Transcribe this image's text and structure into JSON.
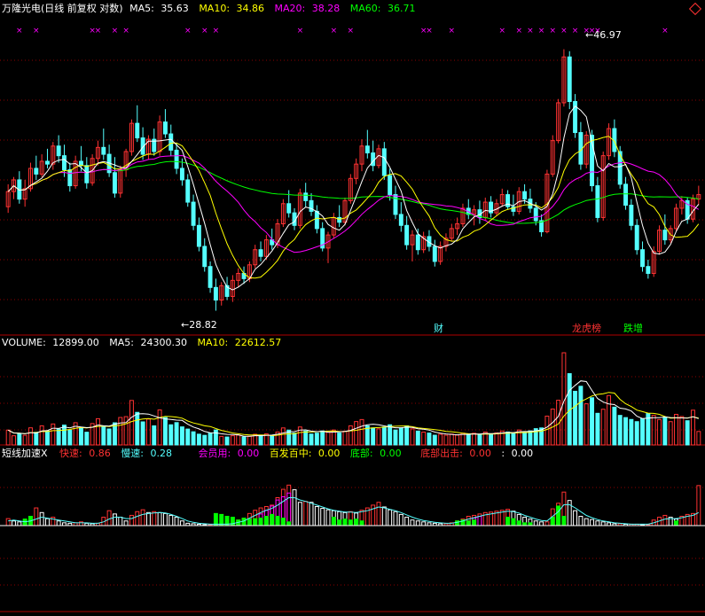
{
  "stock": {
    "name": "万隆光电",
    "mode": "(日线 前复权 对数)"
  },
  "colors": {
    "up": "#ff3232",
    "down": "#54ffff",
    "ma5": "#ffffff",
    "ma10": "#ffff00",
    "ma20": "#ff00ff",
    "ma60": "#00ff00",
    "grid": "#8b0000",
    "flat": "#ffffff"
  },
  "price_panel": {
    "ma5": {
      "label": "MA5:",
      "value": "35.63"
    },
    "ma10": {
      "label": "MA10:",
      "value": "34.86"
    },
    "ma20": {
      "label": "MA20:",
      "value": "38.28"
    },
    "ma60": {
      "label": "MA60:",
      "value": "36.71"
    },
    "high_label": "46.97",
    "low_label": "28.82",
    "event_tags": [
      "财",
      "龙虎榜",
      "跌增"
    ]
  },
  "volume_panel": {
    "volume": {
      "label": "VOLUME:",
      "value": "12899.00"
    },
    "ma5": {
      "label": "MA5:",
      "value": "24300.30"
    },
    "ma10": {
      "label": "MA10:",
      "value": "22612.57"
    }
  },
  "indicator_panel": {
    "title": "短线加速X",
    "fast": {
      "label": "快速:",
      "value": "0.86"
    },
    "slow": {
      "label": "慢速:",
      "value": "0.28"
    },
    "member": {
      "label": "会员用:",
      "value": "0.00"
    },
    "hundred": {
      "label": "百发百中:",
      "value": "0.00"
    },
    "bottom": {
      "label": "底部:",
      "value": "0.00"
    },
    "bottom_out": {
      "label": "底部出击:",
      "value": "0.00"
    },
    "extra": {
      "label": ":",
      "value": "0.00"
    }
  },
  "chart_data": {
    "type": "candlestick",
    "price_range": [
      28.0,
      49.0
    ],
    "volume_range": [
      0,
      90000
    ],
    "indicator_range": [
      0,
      1.2
    ],
    "ohlc": [
      [
        35,
        36.5,
        34.6,
        36
      ],
      [
        36,
        37,
        35.5,
        36.8
      ],
      [
        36.8,
        37.4,
        35.2,
        35.5
      ],
      [
        35.5,
        36.8,
        35,
        36.2
      ],
      [
        36.2,
        38,
        36,
        37.6
      ],
      [
        37.6,
        38.5,
        36.8,
        37.2
      ],
      [
        37.2,
        38.6,
        37,
        38.1
      ],
      [
        38.1,
        39,
        37.6,
        37.9
      ],
      [
        37.9,
        39.5,
        37.5,
        39.2
      ],
      [
        39.2,
        40,
        38,
        38.5
      ],
      [
        38.5,
        39.3,
        37,
        37.5
      ],
      [
        37.5,
        38,
        36,
        36.4
      ],
      [
        36.4,
        38.5,
        36.2,
        38.1
      ],
      [
        38.1,
        39.2,
        37.4,
        37.8
      ],
      [
        37.8,
        38.4,
        36.2,
        36.6
      ],
      [
        36.6,
        38.6,
        36.4,
        38.3
      ],
      [
        38.3,
        39.6,
        37.8,
        39.1
      ],
      [
        39.1,
        40.5,
        38.2,
        38.6
      ],
      [
        38.6,
        39.3,
        37,
        37.3
      ],
      [
        37.3,
        38.4,
        35.6,
        35.9
      ],
      [
        35.9,
        37.8,
        35.6,
        37.5
      ],
      [
        37.5,
        39,
        37,
        38.8
      ],
      [
        38.8,
        41.2,
        38.5,
        40.9
      ],
      [
        40.9,
        42.3,
        39.5,
        39.8
      ],
      [
        39.8,
        40.6,
        38.2,
        38.6
      ],
      [
        38.6,
        40,
        38.2,
        39.7
      ],
      [
        39.7,
        40.5,
        38.5,
        38.8
      ],
      [
        38.8,
        41.5,
        38.5,
        41
      ],
      [
        41,
        42,
        39.8,
        40.1
      ],
      [
        40.1,
        40.8,
        38.5,
        38.9
      ],
      [
        38.9,
        39.4,
        37.2,
        37.6
      ],
      [
        37.6,
        38.3,
        36.4,
        36.8
      ],
      [
        36.8,
        37.2,
        35,
        35.3
      ],
      [
        35.3,
        35.8,
        33.5,
        33.8
      ],
      [
        33.8,
        34.3,
        32.2,
        32.5
      ],
      [
        32.5,
        33,
        31,
        31.3
      ],
      [
        31.3,
        31.6,
        29.8,
        30.1
      ],
      [
        30.1,
        30.6,
        28.82,
        29.4
      ],
      [
        29.4,
        30.4,
        29.1,
        30.2
      ],
      [
        30.2,
        30.7,
        29.4,
        29.6
      ],
      [
        29.6,
        30.8,
        29.3,
        30.5
      ],
      [
        30.5,
        31.2,
        30.1,
        30.9
      ],
      [
        30.9,
        31.3,
        30.3,
        30.6
      ],
      [
        30.6,
        31.6,
        30.4,
        31.4
      ],
      [
        31.4,
        32.6,
        31.2,
        32.3
      ],
      [
        32.3,
        32.8,
        31.6,
        31.9
      ],
      [
        31.9,
        33.2,
        31.7,
        32.9
      ],
      [
        32.9,
        33.6,
        32.3,
        32.6
      ],
      [
        32.6,
        34.2,
        32.4,
        33.9
      ],
      [
        33.9,
        35.5,
        33.7,
        35.2
      ],
      [
        35.2,
        36.1,
        34.3,
        34.6
      ],
      [
        34.6,
        34.9,
        33.5,
        33.8
      ],
      [
        33.8,
        36.2,
        33.6,
        35.9
      ],
      [
        35.9,
        36.6,
        35,
        35.4
      ],
      [
        35.4,
        35.9,
        34.4,
        34.7
      ],
      [
        34.7,
        35.1,
        33.3,
        33.6
      ],
      [
        33.6,
        34,
        32.2,
        32.4
      ],
      [
        32.4,
        33.4,
        31.5,
        33.2
      ],
      [
        33.2,
        34.6,
        33,
        34.3
      ],
      [
        34.3,
        35.1,
        33.7,
        34
      ],
      [
        34,
        35.6,
        33.8,
        35.4
      ],
      [
        35.4,
        37.2,
        35.2,
        36.9
      ],
      [
        36.9,
        38.3,
        36.5,
        37.9
      ],
      [
        37.9,
        39.7,
        37.4,
        39.2
      ],
      [
        39.2,
        40.4,
        38.3,
        38.7
      ],
      [
        38.7,
        39.6,
        37.4,
        37.8
      ],
      [
        37.8,
        39.3,
        37.6,
        39
      ],
      [
        39,
        39.5,
        36.8,
        37.1
      ],
      [
        37.1,
        37.6,
        35.4,
        35.8
      ],
      [
        35.8,
        36.4,
        34.2,
        34.5
      ],
      [
        34.5,
        35.3,
        33.4,
        33.8
      ],
      [
        33.8,
        34.4,
        32.3,
        32.6
      ],
      [
        32.6,
        33.5,
        31.6,
        33.2
      ],
      [
        33.2,
        33.6,
        32,
        32.3
      ],
      [
        32.3,
        33.4,
        32.1,
        33.1
      ],
      [
        33.1,
        33.5,
        32.2,
        32.5
      ],
      [
        32.5,
        32.9,
        31.3,
        31.6
      ],
      [
        31.6,
        32.8,
        31.4,
        32.5
      ],
      [
        32.5,
        33.3,
        32.2,
        33
      ],
      [
        33,
        33.9,
        32.8,
        33.6
      ],
      [
        33.6,
        34.3,
        33.2,
        33.9
      ],
      [
        33.9,
        35.2,
        33.7,
        34.9
      ],
      [
        34.9,
        35.5,
        34.2,
        34.5
      ],
      [
        34.5,
        35.1,
        33.8,
        34.8
      ],
      [
        34.8,
        35.4,
        33.9,
        34.3
      ],
      [
        34.3,
        35.6,
        34.1,
        35.3
      ],
      [
        35.3,
        35.7,
        34.3,
        34.6
      ],
      [
        34.6,
        35.5,
        34.4,
        35.2
      ],
      [
        35.2,
        36.2,
        35,
        35.8
      ],
      [
        35.8,
        36.1,
        34.8,
        35
      ],
      [
        35,
        35.8,
        34.4,
        34.7
      ],
      [
        34.7,
        36.3,
        34.5,
        36
      ],
      [
        36,
        36.5,
        35.2,
        35.5
      ],
      [
        35.5,
        36.2,
        34.6,
        34.9
      ],
      [
        34.9,
        35.3,
        33.8,
        34.1
      ],
      [
        34.1,
        34.5,
        33.1,
        33.4
      ],
      [
        33.4,
        37.5,
        33.3,
        37.2
      ],
      [
        37.2,
        40,
        37,
        39.6
      ],
      [
        39.6,
        42.8,
        39.4,
        42.5
      ],
      [
        42.5,
        46.97,
        42.2,
        46.3
      ],
      [
        46.3,
        46.8,
        42,
        42.6
      ],
      [
        42.6,
        43.2,
        39.8,
        40.2
      ],
      [
        40.2,
        41,
        37.5,
        37.9
      ],
      [
        37.9,
        40.3,
        37.6,
        40
      ],
      [
        40,
        40.4,
        36,
        36.4
      ],
      [
        36.4,
        37,
        34,
        34.3
      ],
      [
        34.3,
        38.8,
        34.1,
        38.5
      ],
      [
        38.5,
        40.9,
        38.2,
        40.5
      ],
      [
        40.5,
        41.2,
        38.4,
        38.8
      ],
      [
        38.8,
        39.2,
        36.2,
        36.5
      ],
      [
        36.5,
        37,
        34.8,
        35.1
      ],
      [
        35.1,
        35.5,
        33.5,
        33.8
      ],
      [
        33.8,
        34.2,
        32,
        32.3
      ],
      [
        32.3,
        32.8,
        31,
        31.3
      ],
      [
        31.3,
        31.7,
        30.6,
        30.9
      ],
      [
        30.9,
        32.5,
        30.7,
        32.2
      ],
      [
        32.2,
        33.8,
        32,
        33.5
      ],
      [
        33.5,
        34.5,
        32.6,
        32.9
      ],
      [
        32.9,
        33.8,
        32.7,
        33.6
      ],
      [
        33.6,
        35.2,
        33.4,
        34.9
      ],
      [
        34.9,
        35.7,
        34.5,
        35.4
      ],
      [
        35.4,
        35.6,
        33.9,
        34.2
      ],
      [
        34.2,
        35.8,
        34,
        35.5
      ],
      [
        35.5,
        36.4,
        35.1,
        35.8
      ]
    ],
    "volume": [
      14200,
      8800,
      10500,
      9200,
      16400,
      12100,
      18300,
      13400,
      20100,
      15200,
      19000,
      14100,
      21300,
      16300,
      12200,
      20500,
      25100,
      17400,
      15300,
      21200,
      26300,
      27100,
      42600,
      31200,
      22100,
      24800,
      18300,
      33500,
      26200,
      19300,
      21400,
      17300,
      15200,
      12600,
      10300,
      9200,
      11400,
      14300,
      8200,
      7600,
      8800,
      9400,
      7600,
      8300,
      10200,
      8900,
      10600,
      9300,
      12400,
      16300,
      14200,
      11300,
      17200,
      13300,
      10400,
      11300,
      13400,
      12300,
      14300,
      11400,
      13200,
      18300,
      22400,
      24300,
      18200,
      16300,
      15400,
      17200,
      19300,
      14300,
      16200,
      18300,
      15400,
      13300,
      12300,
      11400,
      9300,
      10200,
      9300,
      10400,
      9400,
      11300,
      10500,
      11200,
      9800,
      12400,
      10300,
      11600,
      13300,
      12400,
      11500,
      14300,
      12400,
      13500,
      15600,
      16300,
      27600,
      34400,
      42800,
      88300,
      68300,
      51400,
      56200,
      39400,
      45200,
      30300,
      34200,
      47300,
      36200,
      28300,
      26200,
      24400,
      22300,
      25100,
      30200,
      28300,
      24300,
      26200,
      22300,
      29300,
      27200,
      23200,
      33300,
      12899
    ],
    "indicator_fast": [
      0.15,
      0.1,
      0.08,
      0.06,
      0.2,
      0.38,
      0.28,
      0.15,
      0.18,
      0.1,
      0.06,
      0.05,
      0.06,
      0.08,
      0.05,
      0.04,
      0.05,
      0.18,
      0.32,
      0.25,
      0.18,
      0.1,
      0.22,
      0.3,
      0.34,
      0.28,
      0.3,
      0.28,
      0.26,
      0.22,
      0.18,
      0.1,
      0.05,
      0.04,
      0.03,
      0.02,
      0.02,
      0.03,
      0.03,
      0.04,
      0.05,
      0.12,
      0.16,
      0.26,
      0.33,
      0.38,
      0.41,
      0.44,
      0.6,
      0.78,
      0.87,
      0.77,
      0.5,
      0.52,
      0.5,
      0.41,
      0.37,
      0.34,
      0.32,
      0.3,
      0.28,
      0.3,
      0.27,
      0.33,
      0.38,
      0.44,
      0.5,
      0.4,
      0.34,
      0.3,
      0.24,
      0.18,
      0.12,
      0.1,
      0.08,
      0.06,
      0.05,
      0.04,
      0.04,
      0.06,
      0.1,
      0.14,
      0.2,
      0.22,
      0.25,
      0.28,
      0.29,
      0.31,
      0.33,
      0.35,
      0.31,
      0.24,
      0.18,
      0.14,
      0.1,
      0.08,
      0.08,
      0.36,
      0.48,
      0.72,
      0.54,
      0.32,
      0.2,
      0.15,
      0.13,
      0.1,
      0.08,
      0.06,
      0.04,
      0.04,
      0.03,
      0.03,
      0.03,
      0.02,
      0.02,
      0.12,
      0.18,
      0.22,
      0.18,
      0.14,
      0.2,
      0.24,
      0.26,
      0.86
    ],
    "indicator_slow": [
      0.1,
      0.12,
      0.1,
      0.08,
      0.1,
      0.14,
      0.18,
      0.16,
      0.14,
      0.12,
      0.1,
      0.08,
      0.06,
      0.06,
      0.06,
      0.05,
      0.05,
      0.08,
      0.14,
      0.18,
      0.18,
      0.15,
      0.15,
      0.2,
      0.24,
      0.26,
      0.27,
      0.28,
      0.27,
      0.24,
      0.2,
      0.15,
      0.1,
      0.07,
      0.05,
      0.04,
      0.03,
      0.03,
      0.03,
      0.03,
      0.04,
      0.07,
      0.1,
      0.16,
      0.22,
      0.28,
      0.33,
      0.37,
      0.44,
      0.52,
      0.6,
      0.6,
      0.55,
      0.52,
      0.48,
      0.44,
      0.4,
      0.36,
      0.33,
      0.31,
      0.29,
      0.29,
      0.28,
      0.3,
      0.32,
      0.36,
      0.4,
      0.38,
      0.35,
      0.32,
      0.28,
      0.23,
      0.18,
      0.14,
      0.11,
      0.09,
      0.07,
      0.06,
      0.05,
      0.05,
      0.07,
      0.1,
      0.14,
      0.17,
      0.2,
      0.23,
      0.25,
      0.27,
      0.29,
      0.31,
      0.3,
      0.27,
      0.22,
      0.18,
      0.14,
      0.11,
      0.1,
      0.2,
      0.3,
      0.45,
      0.45,
      0.38,
      0.3,
      0.22,
      0.17,
      0.13,
      0.1,
      0.08,
      0.06,
      0.05,
      0.04,
      0.03,
      0.03,
      0.03,
      0.03,
      0.06,
      0.1,
      0.14,
      0.15,
      0.15,
      0.17,
      0.2,
      0.22,
      0.28
    ],
    "indicator_member": [
      0,
      0,
      0,
      0,
      0,
      0,
      0,
      0,
      0,
      0,
      0,
      0,
      0,
      0,
      0,
      0,
      0,
      0,
      0,
      0,
      0,
      0,
      0,
      0,
      0,
      0,
      0,
      0,
      0,
      0,
      0,
      0,
      0,
      0,
      0,
      0,
      0,
      0,
      0,
      0,
      0,
      0,
      0,
      0,
      0,
      0.25,
      0.33,
      0.42,
      0.55,
      0.62,
      0.7,
      0,
      0,
      0,
      0,
      0,
      0,
      0,
      0,
      0,
      0,
      0,
      0,
      0,
      0,
      0,
      0,
      0,
      0,
      0,
      0,
      0,
      0,
      0,
      0,
      0,
      0,
      0,
      0,
      0,
      0,
      0,
      0.1,
      0.16,
      0.2,
      0,
      0,
      0,
      0,
      0,
      0,
      0,
      0,
      0,
      0,
      0,
      0,
      0,
      0,
      0,
      0,
      0,
      0,
      0,
      0,
      0,
      0,
      0,
      0,
      0,
      0,
      0,
      0,
      0,
      0,
      0,
      0,
      0,
      0,
      0,
      0,
      0,
      0,
      0
    ],
    "indicator_bottom": [
      0,
      0,
      0,
      0.14,
      0.2,
      0,
      0,
      0,
      0,
      0,
      0,
      0,
      0,
      0,
      0,
      0,
      0,
      0,
      0,
      0,
      0,
      0,
      0,
      0,
      0,
      0,
      0,
      0,
      0,
      0,
      0,
      0,
      0,
      0,
      0,
      0,
      0,
      0.26,
      0.24,
      0.2,
      0.18,
      0.12,
      0.16,
      0.14,
      0.15,
      0.16,
      0.2,
      0.24,
      0.2,
      0.16,
      0.08,
      0,
      0,
      0,
      0,
      0,
      0,
      0,
      0.18,
      0.12,
      0.14,
      0.12,
      0.14,
      0.1,
      0,
      0,
      0,
      0,
      0,
      0,
      0,
      0,
      0,
      0,
      0,
      0,
      0,
      0,
      0,
      0,
      0.1,
      0.12,
      0.1,
      0.12,
      0,
      0,
      0,
      0,
      0,
      0.18,
      0.15,
      0.1,
      0.06,
      0.06,
      0,
      0,
      0,
      0.18,
      0.42,
      0.2,
      0,
      0,
      0,
      0,
      0,
      0,
      0,
      0,
      0,
      0,
      0,
      0,
      0,
      0,
      0,
      0,
      0,
      0,
      0,
      0.1,
      0,
      0,
      0,
      0
    ]
  }
}
